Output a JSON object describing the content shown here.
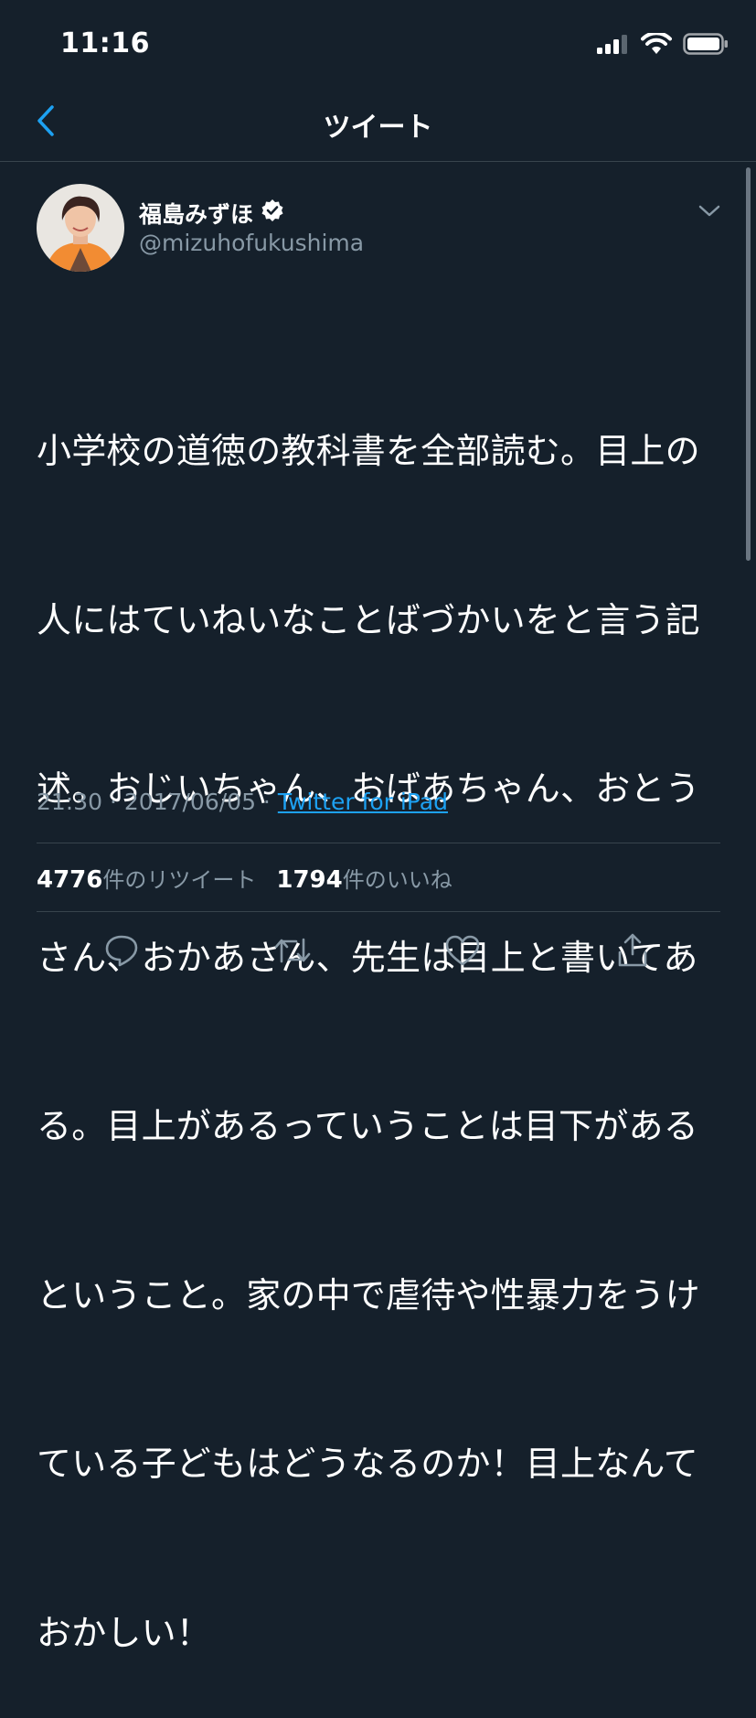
{
  "status_bar": {
    "time": "11:16",
    "icons": [
      "signal-icon",
      "wifi-icon",
      "battery-icon"
    ]
  },
  "nav": {
    "back_icon": "chevron-left-icon",
    "title": "ツイート"
  },
  "tweet": {
    "display_name": "福島みずほ",
    "verified": true,
    "username": "@mizuhofukushima",
    "menu_icon": "chevron-down-icon",
    "text_lines": [
      "小学校の道徳の教科書を全部読む。目上の",
      "人にはていねいなことばづかいをと言う記",
      "述。おじいちゃん、おばあちゃん、おとう",
      "さん、おかあさん、先生は目上と書いてあ",
      "る。目上があるっていうことは目下がある",
      "ということ。家の中で虐待や性暴力をうけ",
      "ている子どもはどうなるのか！目上なんて",
      "おかしい！"
    ],
    "time": "21:30",
    "date": "2017/06/05",
    "separator": " · ",
    "source": "Twitter for iPad",
    "retweet_count": "4776",
    "retweet_label": "件のリツイート",
    "like_count": "1794",
    "like_label": "件のいいね"
  },
  "actions": [
    {
      "name": "reply",
      "icon": "reply-icon"
    },
    {
      "name": "retweet",
      "icon": "retweet-icon"
    },
    {
      "name": "like",
      "icon": "heart-icon"
    },
    {
      "name": "share",
      "icon": "share-icon"
    }
  ],
  "colors": {
    "background": "#15202b",
    "text": "#ffffff",
    "secondary_text": "#8899a6",
    "link": "#1da1f2",
    "accent": "#1da1f2",
    "divider": "#38444d"
  }
}
